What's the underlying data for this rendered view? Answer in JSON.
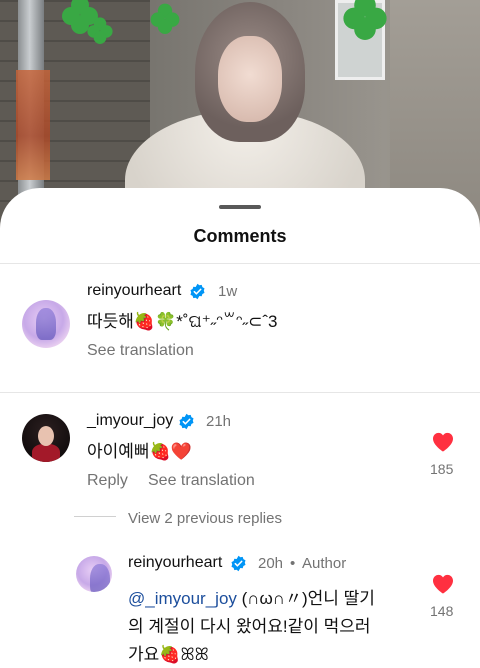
{
  "sheet": {
    "title": "Comments"
  },
  "comments": [
    {
      "username": "reinyourheart",
      "time": "1w",
      "text": "따듯해🍓🍀*˚ଘ⁺˶ᵔ꒳ᵔ˶⊂ˆ3",
      "see_translation": "See translation"
    },
    {
      "username": "_imyour_joy",
      "time": "21h",
      "text": "아이예뻐🍓❤️",
      "reply_label": "Reply",
      "see_translation": "See translation",
      "likes": "185"
    }
  ],
  "view_replies": "View 2 previous replies",
  "reply": {
    "username": "reinyourheart",
    "time": "20h",
    "separator": "•",
    "author_tag": "Author",
    "mention": "@_imyour_joy",
    "line1": " (∩ω∩〃)언니 딸기",
    "line2": "의 계절이 다시 왔어요!같이 먹으러",
    "line3": "가요🍓ꕤꕤ",
    "likes": "148"
  },
  "icons": {
    "verified": "verified-badge-icon",
    "heart": "heart-icon",
    "clover": "clover-sticker"
  },
  "colors": {
    "verified_blue": "#0095f6",
    "heart_red": "#ff3040",
    "mention_blue": "#1c4e9c",
    "muted_gray": "#737373"
  }
}
